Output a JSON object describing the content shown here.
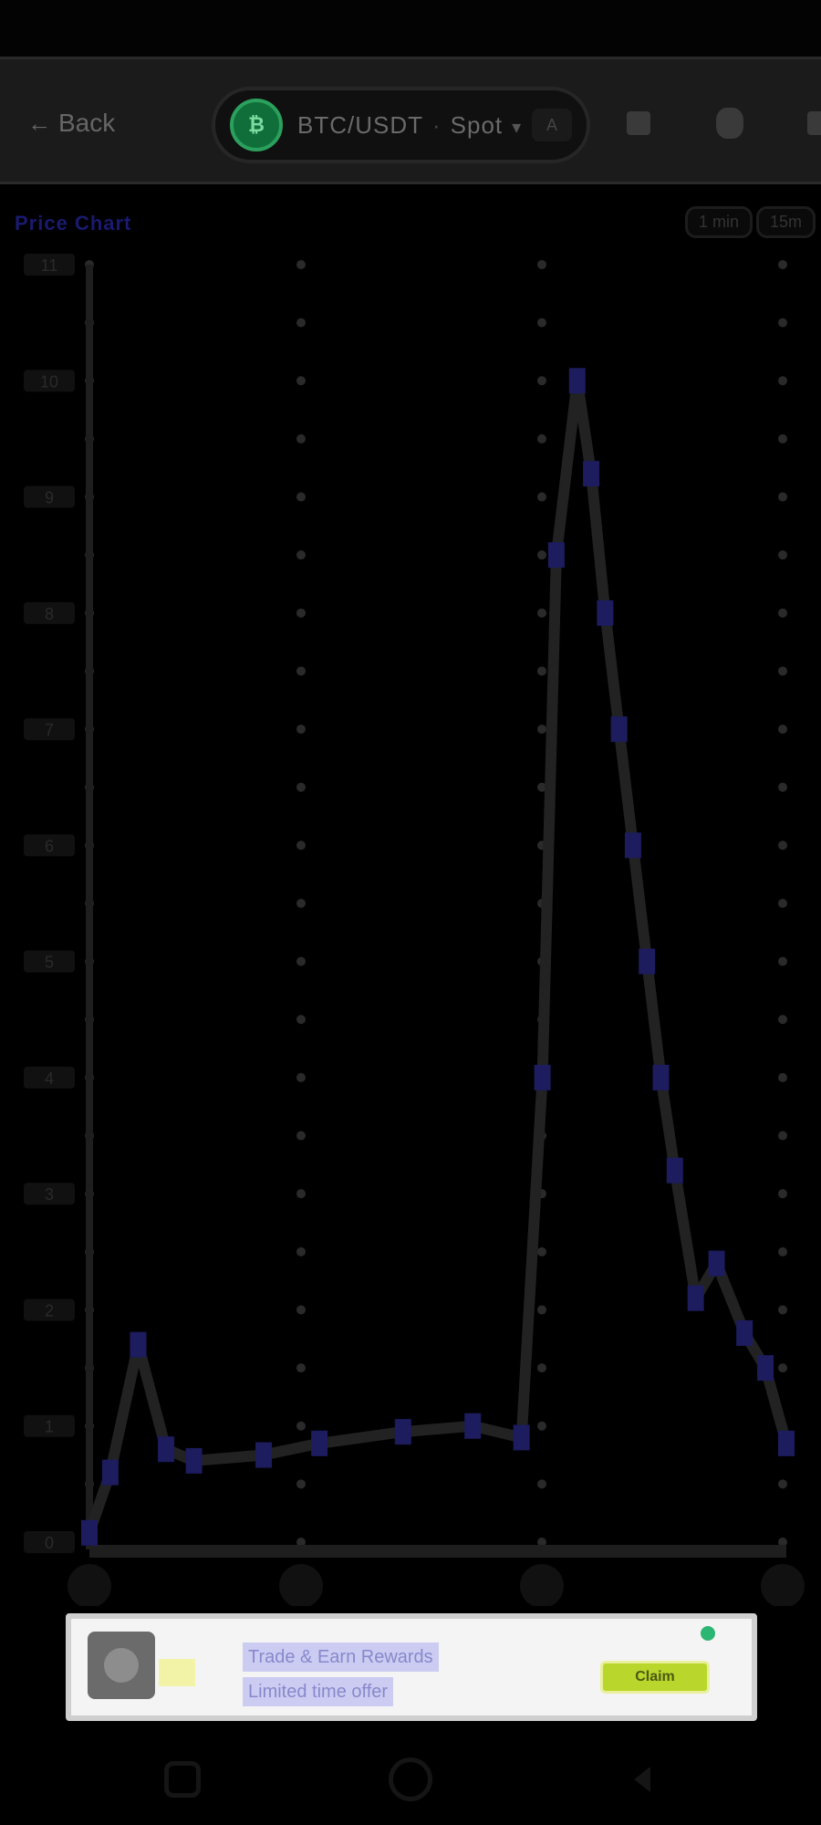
{
  "toolbar": {
    "back_label": "Back",
    "pair": "BTC/USDT",
    "market": "Spot",
    "pair_extra": "A"
  },
  "chart_header": {
    "title": "Price Chart",
    "ranges": [
      "1 min",
      "15m"
    ]
  },
  "chart_data": {
    "type": "line",
    "ylim": [
      0,
      11
    ],
    "y_ticks": [
      0,
      1,
      2,
      3,
      4,
      5,
      6,
      7,
      8,
      9,
      10,
      11
    ],
    "x_ticks": [
      "",
      "",
      "",
      ""
    ],
    "series": [
      {
        "color": "#1c1c5e",
        "points": [
          [
            0.0,
            0.08
          ],
          [
            0.03,
            0.6
          ],
          [
            0.07,
            1.7
          ],
          [
            0.11,
            0.8
          ],
          [
            0.15,
            0.7
          ],
          [
            0.25,
            0.75
          ],
          [
            0.33,
            0.85
          ],
          [
            0.45,
            0.95
          ],
          [
            0.55,
            1.0
          ],
          [
            0.62,
            0.9
          ],
          [
            0.65,
            4.0
          ],
          [
            0.67,
            8.5
          ],
          [
            0.7,
            10.0
          ],
          [
            0.72,
            9.2
          ],
          [
            0.74,
            8.0
          ],
          [
            0.76,
            7.0
          ],
          [
            0.78,
            6.0
          ],
          [
            0.8,
            5.0
          ],
          [
            0.82,
            4.0
          ],
          [
            0.84,
            3.2
          ],
          [
            0.87,
            2.1
          ],
          [
            0.9,
            2.4
          ],
          [
            0.94,
            1.8
          ],
          [
            0.97,
            1.5
          ],
          [
            1.0,
            0.85
          ]
        ]
      }
    ]
  },
  "promo": {
    "line1": "Trade & Earn Rewards",
    "line2": "Limited time offer",
    "cta": "Claim"
  },
  "colors": {
    "line": "#222222",
    "marker": "#1c1c6e",
    "axis": "#1e1e1e",
    "grid_dot": "#2a2a2a"
  }
}
